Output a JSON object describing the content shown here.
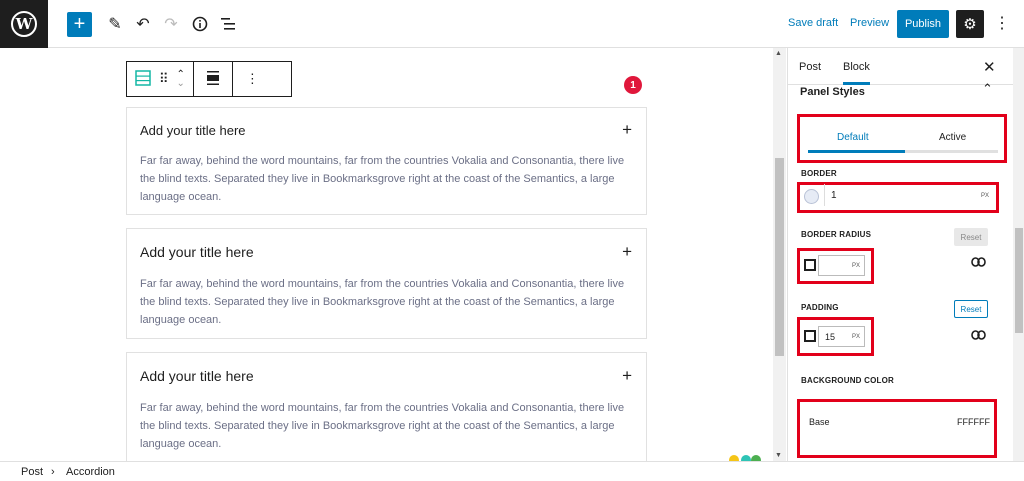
{
  "toolbar": {
    "logo_letter": "W",
    "add_icon": "plus-icon",
    "tools": [
      "pencil-icon",
      "undo-icon",
      "redo-icon",
      "info-icon",
      "list-view-icon"
    ],
    "save_draft": "Save draft",
    "preview": "Preview",
    "publish": "Publish",
    "settings_icon": "gear-icon",
    "more_icon": "more-vertical-icon"
  },
  "block_toolbar": {
    "icons": [
      "accordion-block-icon",
      "drag-handle-icon",
      "move-up-icon",
      "move-down-icon",
      "align-icon",
      "more-options-icon"
    ]
  },
  "badge": {
    "number": "1",
    "color": "#e0173b"
  },
  "accordion": {
    "items": [
      {
        "title": "Add your title here",
        "toggle": "+",
        "body": "Far far away, behind the word mountains, far from the countries Vokalia and Consonantia, there live the blind texts. Separated they live in Bookmarksgrove right at the coast of the Semantics, a large language ocean."
      },
      {
        "title": "Add your title here",
        "toggle": "+",
        "body": "Far far away, behind the word mountains, far from the countries Vokalia and Consonantia, there live the blind texts. Separated they live in Bookmarksgrove right at the coast of the Semantics, a large language ocean."
      },
      {
        "title": "Add your title here",
        "toggle": "+",
        "body": "Far far away, behind the word mountains, far from the countries Vokalia and Consonantia, there live the blind texts. Separated they live in Bookmarksgrove right at the coast of the Semantics, a large language ocean."
      }
    ]
  },
  "sidebar": {
    "tabs": {
      "post": "Post",
      "block": "Block"
    },
    "close": "✕",
    "panel_title": "Panel Styles",
    "state_tabs": {
      "default": "Default",
      "active": "Active"
    },
    "border": {
      "label": "BORDER",
      "value": "1",
      "unit": "PX"
    },
    "border_radius": {
      "label": "BORDER RADIUS",
      "reset": "Reset",
      "value": "",
      "unit": "PX"
    },
    "padding": {
      "label": "PADDING",
      "reset": "Reset",
      "value": "15",
      "unit": "PX"
    },
    "background": {
      "label": "BACKGROUND COLOR",
      "base_label": "Base",
      "hex": "FFFFFF"
    }
  },
  "footer": {
    "crumbs": [
      "Post",
      "Accordion"
    ],
    "separator": "›"
  },
  "colors": {
    "accent": "#007cba",
    "highlight": "#e2001a",
    "badge": "#e0173b"
  }
}
